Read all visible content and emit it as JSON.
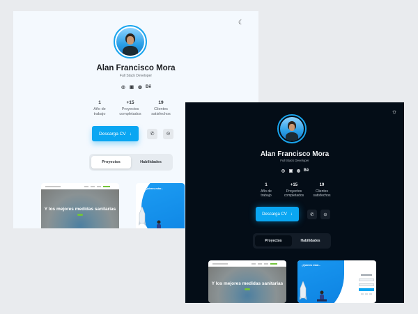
{
  "profile": {
    "name": "Alan Francisco Mora",
    "role": "Full Stack Developer"
  },
  "socials": [
    {
      "icon": "instagram-icon",
      "glyph": "◎"
    },
    {
      "icon": "linkedin-icon",
      "glyph": "▣"
    },
    {
      "icon": "github-icon",
      "glyph": "◍"
    },
    {
      "icon": "behance-icon",
      "glyph": "Bē"
    }
  ],
  "stats": [
    {
      "value": "1",
      "line1": "Año de",
      "line2": "trabajo"
    },
    {
      "value": "+15",
      "line1": "Proyectos",
      "line2": "completados"
    },
    {
      "value": "19",
      "line1": "Clientes",
      "line2": "satisfechos"
    }
  ],
  "cta": {
    "download_label": "Descarga CV",
    "download_icon": "↓",
    "whatsapp_icon": "✆",
    "messenger_icon": "⊝"
  },
  "tabs": [
    {
      "label": "Proyectos",
      "active": true
    },
    {
      "label": "Habilidades",
      "active": false
    }
  ],
  "theme": {
    "light_toggle_icon": "☾",
    "dark_toggle_icon": "☼",
    "accent": "#0aa6f2",
    "light_bg": "#f4f9fe",
    "dark_bg": "#040d17"
  },
  "projects": {
    "health_site_title": "Y los mejores medidas sanitarias",
    "curve_site_label": "¿Quieres estar..."
  }
}
